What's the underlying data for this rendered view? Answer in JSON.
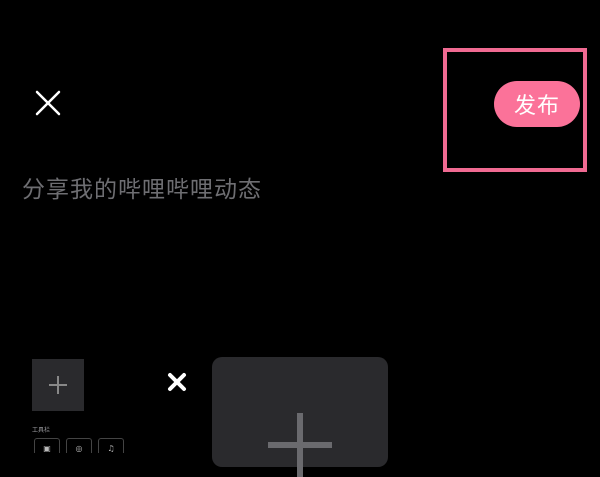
{
  "header": {
    "close_icon": "close-icon",
    "publish_label": "发布"
  },
  "editor": {
    "placeholder": "分享我的哔哩哔哩动态"
  },
  "instruction": {
    "highlight_color": "#F06A92",
    "times_icon": "times-icon"
  },
  "mini_screenshot": {
    "add_icon": "plus-icon",
    "toolbar_label": "工具栏",
    "tool_glyphs": [
      "▣",
      "◎",
      "♫"
    ]
  },
  "media": {
    "add_icon": "plus-icon"
  },
  "colors": {
    "background": "#000000",
    "accent": "#FB7299",
    "placeholder_text": "#6E6E72",
    "tile": "#2A2A2D"
  }
}
